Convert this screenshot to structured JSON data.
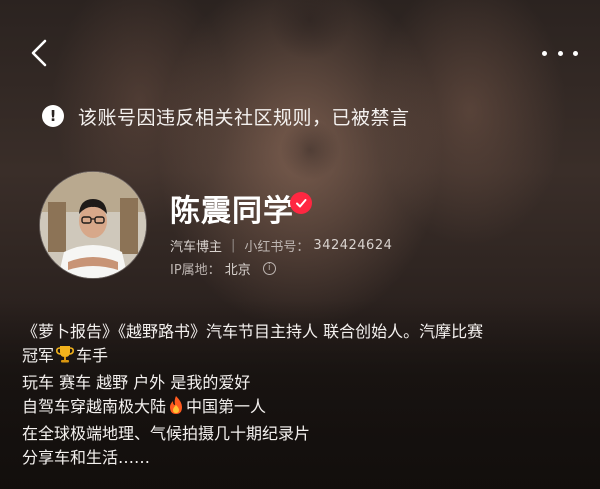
{
  "nav": {
    "back_icon": "chevron-left-icon",
    "more_icon": "more-horizontal-icon"
  },
  "banner": {
    "icon": "alert-icon",
    "icon_glyph": "!",
    "text": "该账号因违反相关社区规则，已被禁言"
  },
  "profile": {
    "name": "陈震同学",
    "verified": true,
    "verified_color": "#ff2741",
    "role": "汽车博主",
    "id_label": "小红书号：",
    "id_value": "342424624",
    "ip_label": "IP属地：",
    "ip_value": "北京",
    "info_glyph": "i"
  },
  "bio": {
    "line1": "《萝卜报告》《越野路书》汽车节目主持人 联合创始人。汽摩比赛",
    "line2_a": "冠军",
    "line2_b": "车手",
    "line3": "玩车 赛车 越野 户外 是我的爱好",
    "line4_a": "自驾车穿越南极大陆",
    "line4_b": "中国第一人",
    "line5": "在全球极端地理、气候拍摄几十期纪录片",
    "line6": "分享车和生活……"
  }
}
